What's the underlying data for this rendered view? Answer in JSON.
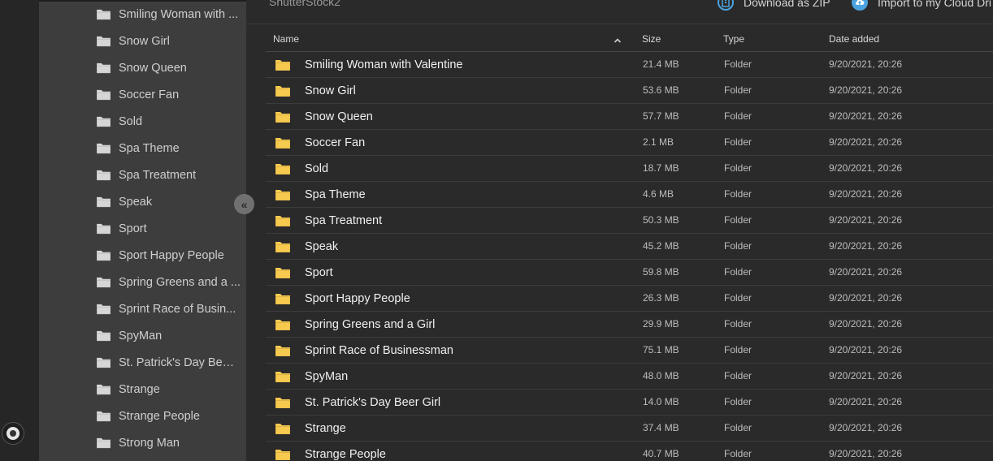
{
  "sidebar": {
    "items": [
      {
        "label": "Smiling Woman with ..."
      },
      {
        "label": "Snow Girl"
      },
      {
        "label": "Snow Queen"
      },
      {
        "label": "Soccer Fan"
      },
      {
        "label": "Sold"
      },
      {
        "label": "Spa Theme"
      },
      {
        "label": "Spa Treatment"
      },
      {
        "label": "Speak"
      },
      {
        "label": "Sport"
      },
      {
        "label": "Sport Happy People"
      },
      {
        "label": "Spring Greens and a ..."
      },
      {
        "label": "Sprint Race of Busin..."
      },
      {
        "label": "SpyMan"
      },
      {
        "label": "St. Patrick's Day Beer..."
      },
      {
        "label": "Strange"
      },
      {
        "label": "Strange People"
      },
      {
        "label": "Strong Man"
      }
    ],
    "collapse_icon": "double-chevron-left-icon"
  },
  "header": {
    "breadcrumb": "ShutterStock2",
    "download_label": "Download as ZIP",
    "import_label": "Import to my Cloud Dri",
    "accent_color": "#4aa3df"
  },
  "table": {
    "columns": {
      "name": "Name",
      "size": "Size",
      "type": "Type",
      "date": "Date added"
    },
    "sort_icon": "chevron-up-icon",
    "rows": [
      {
        "name": "Smiling Woman with Valentine",
        "size": "21.4 MB",
        "type": "Folder",
        "date": "9/20/2021, 20:26"
      },
      {
        "name": "Snow Girl",
        "size": "53.6 MB",
        "type": "Folder",
        "date": "9/20/2021, 20:26"
      },
      {
        "name": "Snow Queen",
        "size": "57.7 MB",
        "type": "Folder",
        "date": "9/20/2021, 20:26"
      },
      {
        "name": "Soccer Fan",
        "size": "2.1 MB",
        "type": "Folder",
        "date": "9/20/2021, 20:26"
      },
      {
        "name": "Sold",
        "size": "18.7 MB",
        "type": "Folder",
        "date": "9/20/2021, 20:26"
      },
      {
        "name": "Spa Theme",
        "size": "4.6 MB",
        "type": "Folder",
        "date": "9/20/2021, 20:26"
      },
      {
        "name": "Spa Treatment",
        "size": "50.3 MB",
        "type": "Folder",
        "date": "9/20/2021, 20:26"
      },
      {
        "name": "Speak",
        "size": "45.2 MB",
        "type": "Folder",
        "date": "9/20/2021, 20:26"
      },
      {
        "name": "Sport",
        "size": "59.8 MB",
        "type": "Folder",
        "date": "9/20/2021, 20:26"
      },
      {
        "name": "Sport Happy People",
        "size": "26.3 MB",
        "type": "Folder",
        "date": "9/20/2021, 20:26"
      },
      {
        "name": "Spring Greens and a Girl",
        "size": "29.9 MB",
        "type": "Folder",
        "date": "9/20/2021, 20:26"
      },
      {
        "name": "Sprint Race of Businessman",
        "size": "75.1 MB",
        "type": "Folder",
        "date": "9/20/2021, 20:26"
      },
      {
        "name": "SpyMan",
        "size": "48.0 MB",
        "type": "Folder",
        "date": "9/20/2021, 20:26"
      },
      {
        "name": "St. Patrick's Day Beer Girl",
        "size": "14.0 MB",
        "type": "Folder",
        "date": "9/20/2021, 20:26"
      },
      {
        "name": "Strange",
        "size": "37.4 MB",
        "type": "Folder",
        "date": "9/20/2021, 20:26"
      },
      {
        "name": "Strange People",
        "size": "40.7 MB",
        "type": "Folder",
        "date": "9/20/2021, 20:26"
      }
    ]
  },
  "colors": {
    "folder_yellow": "#f6c94f",
    "folder_grey": "#d6d6d6",
    "main_bg": "#2a2a2a",
    "sidebar_bg": "#3d3d3d"
  }
}
